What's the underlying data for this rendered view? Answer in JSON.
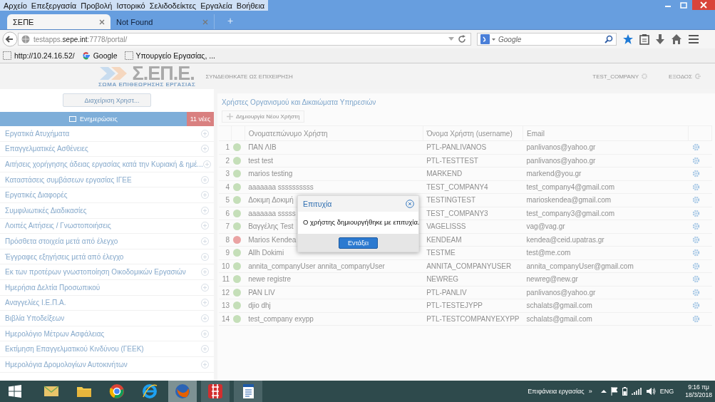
{
  "browser": {
    "menu": [
      "Αρχείο",
      "Επεξεργασία",
      "Προβολή",
      "Ιστορικό",
      "Σελιδοδείκτες",
      "Εργαλεία",
      "Βοήθεια"
    ],
    "tabs": [
      {
        "label": "ΣΕΠΕ",
        "selected": true
      },
      {
        "label": "Not Found",
        "selected": false
      }
    ],
    "new_tab": "+",
    "url": "testapps.**sepe.int**:7778/portal/",
    "search": {
      "placeholder": "Google"
    },
    "bookmarks": [
      "http://10.24.16.52/",
      "Google",
      "Υπουργείο Εργασίας, ..."
    ]
  },
  "header": {
    "logo": "Σ.ΕΠ.Ε.",
    "logo_subtitle": "ΣΩΜΑ ΕΠΙΘΕΩΡΗΣΗΣ ΕΡΓΑΣΙΑΣ",
    "login_note": "ΣΥΝΔΕΘΗΚΑΤΕ ΩΣ ΕΠΙΧΕΙΡΗΣΗ",
    "user": "TEST_COMPANY",
    "logout": "ΕΞΟΔΟΣ"
  },
  "sidebar": {
    "manage_button": "Διαχείριση Χρηστ...",
    "notifications": {
      "label": "Ενημερώσεις",
      "badge": "11 νέες"
    },
    "items": [
      "Εργατικά Ατυχήματα",
      "Επαγγελματικές Ασθένειες",
      "Αιτήσεις χορήγησης άδειας εργασίας κατά την Κυριακή & ημέ...",
      "Καταστάσεις συμβάσεων εργασίας ΙΓΕΕ",
      "Εργατικές Διαφορές",
      "Συμφιλιωτικές Διαδικασίες",
      "Λοιπές Αιτήσεις / Γνωστοποιήσεις",
      "Πρόσθετα στοιχεία μετά από έλεγχο",
      "Έγγραφες εξηγήσεις μετά από έλεγχο",
      "Εκ των προτέρων γνωστοποίηση Οικοδομικών Εργασιών",
      "Ημερήσια Δελτία Προσωπικού",
      "Αναγγελίες Ι.Ε.Π.Α.",
      "Βιβλία Υποδείξεων",
      "Ημερολόγιο Μέτρων Ασφάλειας",
      "Εκτίμηση Επαγγελματικού Κινδύνου (ΓΕΕΚ)",
      "Ημερολόγια Δρομολογίων Αυτοκινήτων"
    ]
  },
  "content": {
    "title": "Χρήστες Οργανισμού και Δικαιώματα Υπηρεσιών",
    "create_button": "Δημιουργία Νέου Χρήστη",
    "table": {
      "columns": [
        "Ονοματεπώνυμο Χρήστη",
        "Όνομα Χρήστη (username)",
        "Email"
      ],
      "rows": [
        {
          "number": "1",
          "color": "#c5dfb9",
          "name": "ΠΑΝ ΛΙΒ",
          "username": "PTL-PANLIVANOS",
          "email": "panlivanos@yahoo.gr"
        },
        {
          "number": "2",
          "color": "#c5dfb9",
          "name": "test test",
          "username": "PTL-TESTTEST",
          "email": "panlivanos@yahoo.gr"
        },
        {
          "number": "3",
          "color": "#c5dfb9",
          "name": "marios testing",
          "username": "MARKEND",
          "email": "markend@you.gr"
        },
        {
          "number": "4",
          "color": "#c5dfb9",
          "name": "aaaaaaa ssssssssss",
          "username": "TEST_COMPANY4",
          "email": "test_company4@gmail.com"
        },
        {
          "number": "5",
          "color": "#c5dfb9",
          "name": "Δοκιμη Δοκιμή",
          "username": "TESTINGTEST",
          "email": "marioskendea@gmail.com"
        },
        {
          "number": "6",
          "color": "#c5dfb9",
          "name": "aaaaaaa sssss",
          "username": "TEST_COMPANY3",
          "email": "test_company3@gmail.com"
        },
        {
          "number": "7",
          "color": "#c5dfb9",
          "name": "Βαγγέλης Test",
          "username": "VAGELISSS",
          "email": "vag@vag.gr"
        },
        {
          "number": "8",
          "color": "#eaa3a3",
          "name": "Marios Kendea",
          "username": "KENDEAM",
          "email": "kendea@ceid.upatras.gr"
        },
        {
          "number": "9",
          "color": "#c5dfb9",
          "name": "Allh Dokimi",
          "username": "TESTME",
          "email": "test@me.com"
        },
        {
          "number": "10",
          "color": "#c5dfb9",
          "name": "annita_companyUser annita_companyUser",
          "username": "ANNITA_COMPANYUSER",
          "email": "annita_companyUser@gmail.com"
        },
        {
          "number": "11",
          "color": "#c5dfb9",
          "name": "newe registre",
          "username": "NEWREG",
          "email": "newreg@new.gr"
        },
        {
          "number": "12",
          "color": "#c5dfb9",
          "name": "PAN LIV",
          "username": "PTL-PANLIV",
          "email": "panlivanos@yahoo.gr"
        },
        {
          "number": "13",
          "color": "#c5dfb9",
          "name": "djio dhj",
          "username": "PTL-TESTEJYPP",
          "email": "schalats@gmail.com"
        },
        {
          "number": "14",
          "color": "#c5dfb9",
          "name": "test_company exypp",
          "username": "PTL-TESTCOMPANYEXYPP",
          "email": "schalats@gmail.com"
        }
      ]
    }
  },
  "dialog": {
    "title": "Επιτυχία",
    "message": "Ο χρήστης δημιουργήθηκε με επιτυχία.",
    "button": "Εντάξει"
  },
  "taskbar": {
    "apps": [
      {
        "running": false,
        "selected": false
      },
      {
        "running": false,
        "selected": false
      },
      {
        "running": false,
        "selected": false
      },
      {
        "running": false,
        "selected": false
      },
      {
        "running": true,
        "selected": true
      },
      {
        "running": true,
        "selected": false
      },
      {
        "running": true,
        "selected": false
      }
    ],
    "desktop_label": "Επιφάνεια εργασίας",
    "overflow": "»",
    "language": "ENG",
    "time": "9:16 πμ",
    "date": "18/3/2018"
  }
}
